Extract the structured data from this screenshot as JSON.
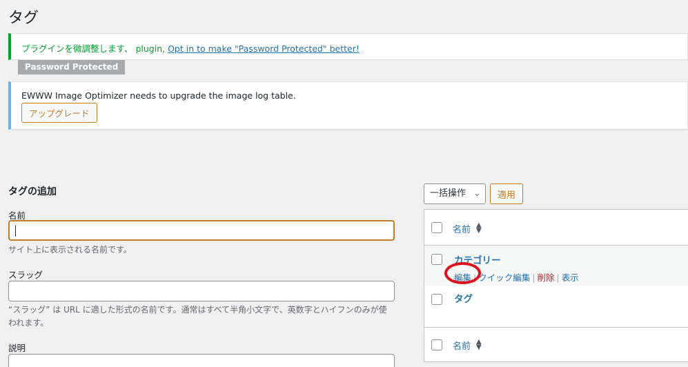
{
  "page": {
    "title": "タグ"
  },
  "notices": {
    "plugin": {
      "text": "プラグインを微調整します、 plugin, ",
      "link": "Opt in to make \"Password Protected\" better!",
      "badge": "Password Protected"
    },
    "ewww": {
      "text": "EWWW Image Optimizer needs to upgrade the image log table.",
      "button": "アップグレード"
    }
  },
  "form": {
    "heading": "タグの追加",
    "name_label": "名前",
    "name_value": "",
    "name_help": "サイト上に表示される名前です。",
    "slug_label": "スラッグ",
    "slug_value": "",
    "slug_help": "“スラッグ” は URL に適した形式の名前です。通常はすべて半角小文字で、英数字とハイフンのみが使われます。",
    "desc_label": "説明"
  },
  "bulk": {
    "select_value": "一括操作",
    "apply_label": "適用"
  },
  "table": {
    "column_name": "名前",
    "rows": [
      {
        "name": "カテゴリー",
        "actions": [
          "編集",
          "クイック編集",
          "削除",
          "表示"
        ]
      },
      {
        "name": "タグ"
      }
    ]
  },
  "colors": {
    "accent": "#2271b1",
    "success": "#00a32a",
    "info": "#72aee6",
    "button_orange": "#c57a25",
    "danger": "#b32d2e",
    "highlight_circle": "#e0101a"
  }
}
